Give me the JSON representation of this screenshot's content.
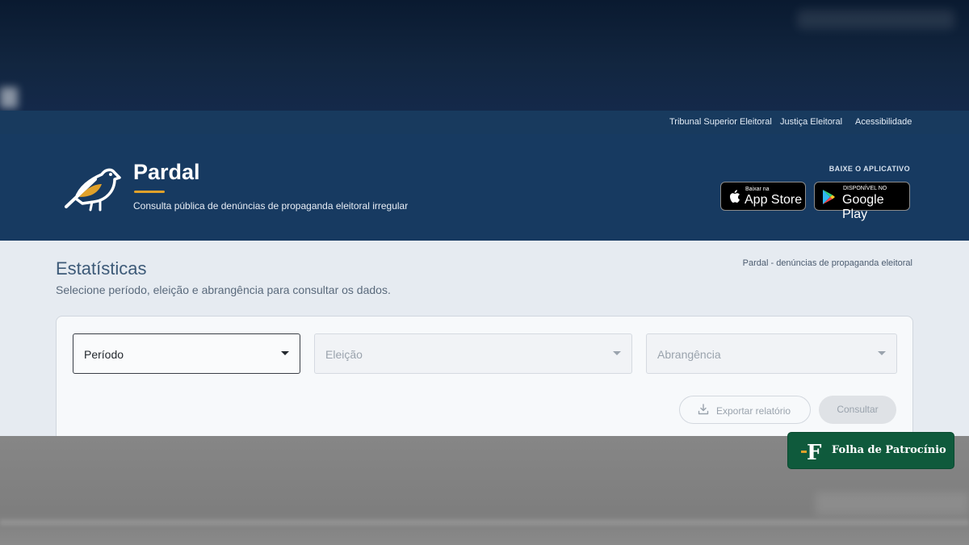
{
  "utility_nav": {
    "links": [
      "Tribunal Superior Eleitoral",
      "Justiça Eleitoral",
      "Acessibilidade"
    ]
  },
  "header": {
    "brand_title": "Pardal",
    "brand_subtitle": "Consulta pública de denúncias de propaganda eleitoral irregular",
    "app_label": "BAIXE O APLICATIVO",
    "app_store": {
      "small": "Baixar na",
      "big": "App Store"
    },
    "google_play": {
      "small": "DISPONÍVEL NO",
      "big": "Google Play"
    }
  },
  "main": {
    "title": "Estatísticas",
    "subtitle": "Selecione período, eleição e abrangência para consultar os dados.",
    "breadcrumb": "Pardal - denúncias de propaganda eleitoral",
    "filters": {
      "periodo": "Período",
      "eleicao": "Eleição",
      "abrangencia": "Abrangência"
    },
    "export_label": "Exportar relatório",
    "consult_label": "Consultar"
  },
  "watermark": {
    "letter": "F",
    "text": "Folha de Patrocínio"
  },
  "colors": {
    "header_bg": "#173a61",
    "utility_bg": "#183a5e",
    "accent": "#e0a12a",
    "watermark_bg": "#0f5a3c"
  }
}
